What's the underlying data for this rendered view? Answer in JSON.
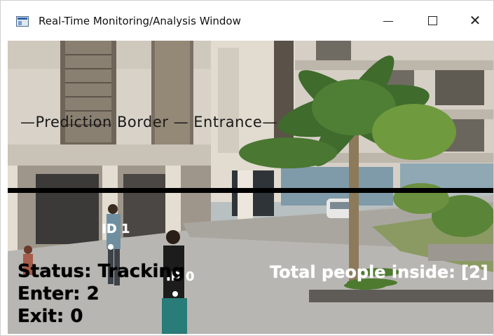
{
  "window": {
    "title": "Real-Time Monitoring/Analysis Window",
    "icon": "app-window-icon",
    "controls": {
      "minimize": "minimize-icon",
      "maximize": "maximize-icon",
      "close_label": "✕"
    }
  },
  "video": {
    "border_label": "—Prediction Border — Entrance—",
    "status_text": "Status: Tracking",
    "enter_text": "Enter: 2",
    "exit_text": "Exit: 0",
    "total_text": "Total people inside: [2]",
    "tracked_ids": [
      {
        "label": "ID 1"
      },
      {
        "label": "ID 0"
      }
    ],
    "colors": {
      "border_line": "#000000",
      "hud_text": "#000000",
      "overlay_text": "#ffffff"
    }
  }
}
